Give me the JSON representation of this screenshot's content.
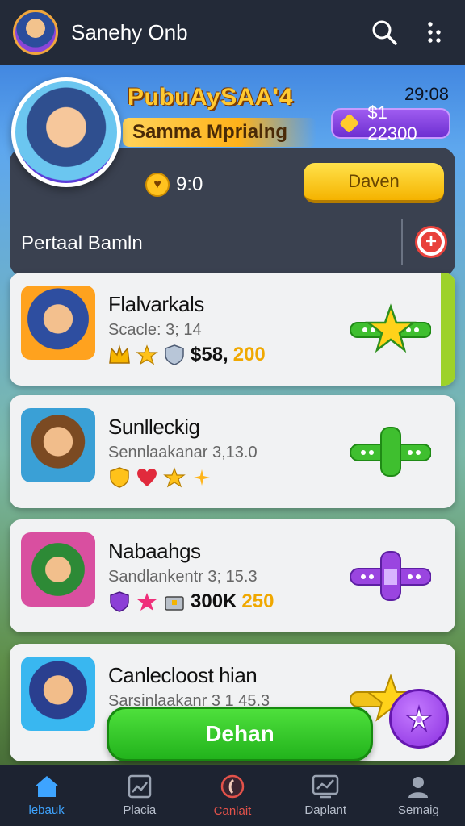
{
  "header": {
    "title": "Sanehy Onb",
    "search_icon": "search-icon",
    "menu_icon": "more-vertical-icon"
  },
  "hero": {
    "title": "PubuAySAA'4",
    "subtitle": "Samma Mprialng",
    "time": "29:08",
    "coins": "$1 22300"
  },
  "panel": {
    "score": "9:0",
    "primary_button": "Daven",
    "section_label": "Pertaal Bamln"
  },
  "list": [
    {
      "name": "Flalvarkals",
      "meta": "Scacle: 3; 14",
      "amount": "$58,",
      "amount_accent": "200",
      "action_color": "#3fbf2f"
    },
    {
      "name": "Sunlleckig",
      "meta": "Sennlaakanar 3,13.0",
      "amount": "",
      "amount_accent": "",
      "action_color": "#3fbf2f"
    },
    {
      "name": "Nabaahgs",
      "meta": "Sandlankentr 3; 15.3",
      "amount": "300K",
      "amount_accent": "250",
      "action_color": "#9a45e0"
    },
    {
      "name": "Canlecloost hian",
      "meta": "Sarsinlaakanr 3 1 45.3",
      "amount": "",
      "amount_accent": "",
      "action_color": "#f2c31a"
    }
  ],
  "cta": {
    "label": "Dehan"
  },
  "nav": [
    {
      "label": "lebauk",
      "icon": "home-icon"
    },
    {
      "label": "Placia",
      "icon": "image-icon"
    },
    {
      "label": "Canlait",
      "icon": "live-icon"
    },
    {
      "label": "Daplant",
      "icon": "chart-icon"
    },
    {
      "label": "Semaig",
      "icon": "profile-icon"
    }
  ],
  "colors": {
    "topbar": "#232a38",
    "accent_yellow": "#f5b300",
    "accent_purple": "#8a2fe0",
    "accent_green": "#22b31c",
    "nav_active": "#3ea4ff"
  }
}
